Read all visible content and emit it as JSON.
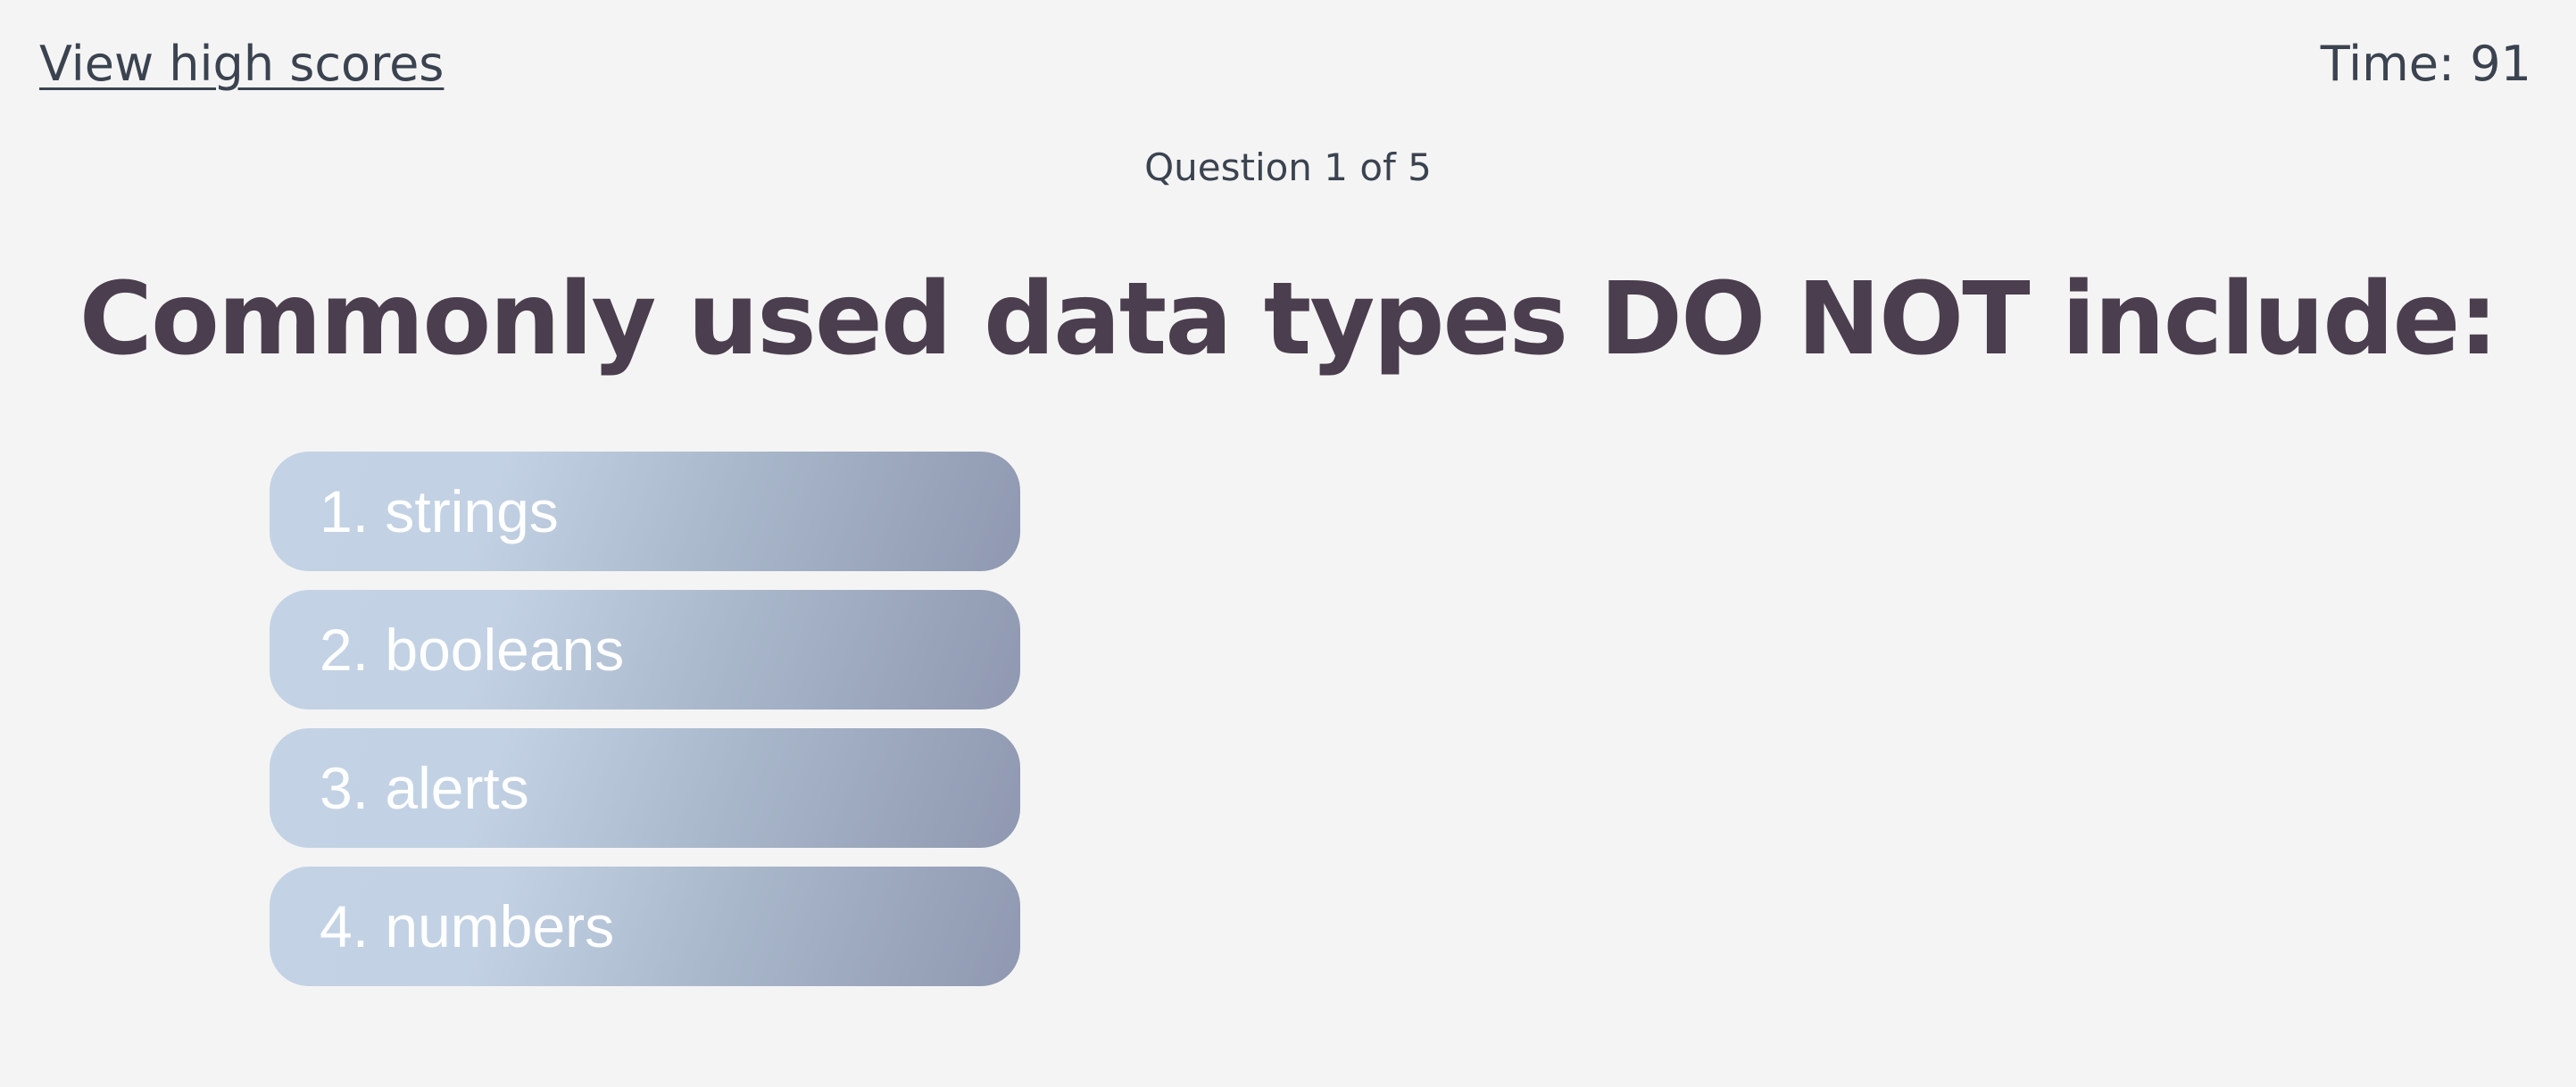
{
  "header": {
    "high_scores_label": "View high scores",
    "timer_label": "Time: 91"
  },
  "quiz": {
    "progress": "Question 1 of 5",
    "question": "Commonly used data types DO NOT include:",
    "choices": [
      {
        "label": "1. strings"
      },
      {
        "label": "2. booleans"
      },
      {
        "label": "3. alerts"
      },
      {
        "label": "4. numbers"
      }
    ]
  },
  "colors": {
    "background": "#f4f4f4",
    "text": "#3b4350",
    "question_text": "#4b3e4e",
    "button_gradient_start": "#c3d3e5",
    "button_gradient_end": "#8f98b0",
    "button_text": "#ffffff"
  }
}
